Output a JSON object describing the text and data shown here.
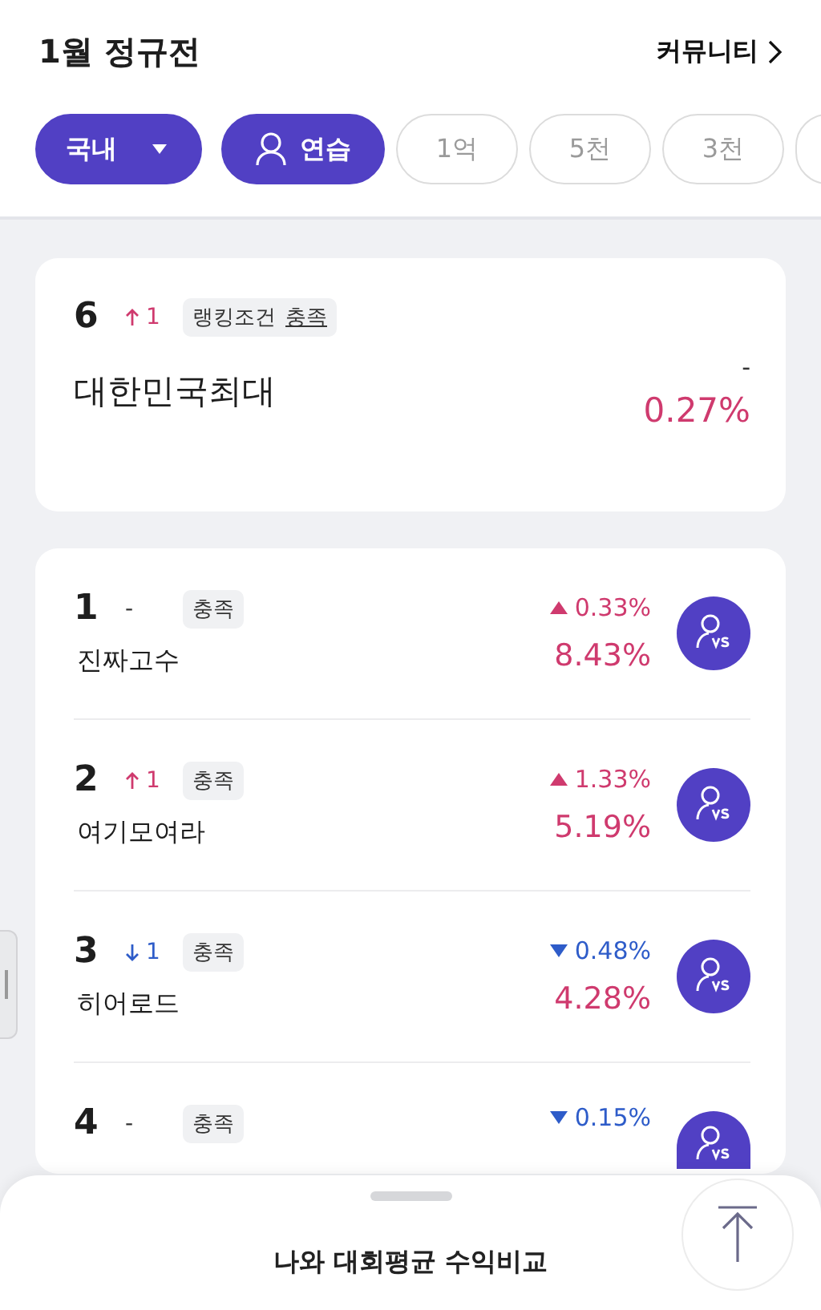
{
  "header": {
    "title": "1월 정규전",
    "link": "커뮤니티"
  },
  "chips": [
    {
      "label": "국내",
      "kind": "dropdown",
      "selected": true
    },
    {
      "label": "연습",
      "kind": "person",
      "selected": true
    },
    {
      "label": "1억",
      "kind": "plain",
      "selected": false
    },
    {
      "label": "5천",
      "kind": "plain",
      "selected": false
    },
    {
      "label": "3천",
      "kind": "plain",
      "selected": false
    }
  ],
  "my_rank": {
    "rank": "6",
    "change": {
      "kind": "up",
      "amount": "1"
    },
    "condition": {
      "label": "랭킹조건",
      "status": "충족"
    },
    "name": "대한민국최대",
    "daily": {
      "value": "-"
    },
    "return": "0.27%"
  },
  "ranking": [
    {
      "rank": "1",
      "change": {
        "kind": "none",
        "amount": "-"
      },
      "badge": "충족",
      "name": "진짜고수",
      "daily": {
        "kind": "up",
        "value": "0.33%"
      },
      "return": "8.43%"
    },
    {
      "rank": "2",
      "change": {
        "kind": "up",
        "amount": "1"
      },
      "badge": "충족",
      "name": "여기모여라",
      "daily": {
        "kind": "up",
        "value": "1.33%"
      },
      "return": "5.19%"
    },
    {
      "rank": "3",
      "change": {
        "kind": "down",
        "amount": "1"
      },
      "badge": "충족",
      "name": "히어로드",
      "daily": {
        "kind": "down",
        "value": "0.48%"
      },
      "return": "4.28%"
    },
    {
      "rank": "4",
      "change": {
        "kind": "none",
        "amount": "-"
      },
      "badge": "충족",
      "daily": {
        "kind": "down",
        "value": "0.15%"
      }
    }
  ],
  "bottom_sheet": {
    "title": "나와 대회평균 수익비교"
  }
}
